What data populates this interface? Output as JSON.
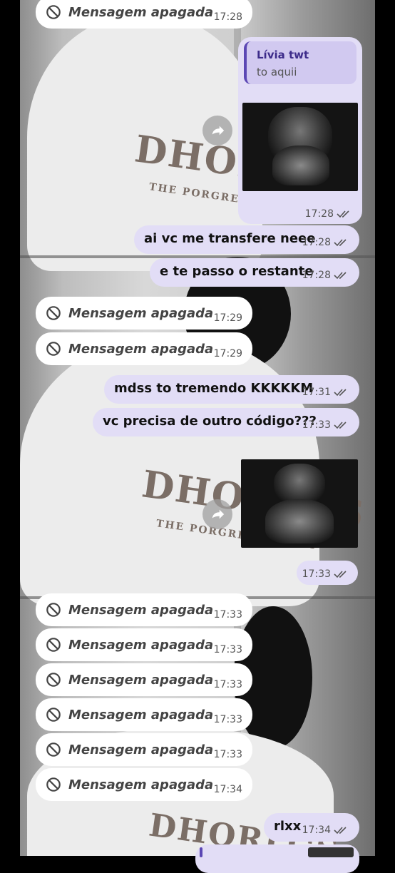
{
  "deleted_label": "Mensagem apagada",
  "quote": {
    "name": "Lívia twt",
    "text": "to aquii"
  },
  "messages": [
    {
      "time": "17:28"
    },
    {
      "time": "17:28"
    },
    {
      "text": "ai vc me transfere neee",
      "time": "17:28"
    },
    {
      "text": "e te passo o restante",
      "time": "17:28"
    },
    {
      "time": "17:29"
    },
    {
      "time": "17:29"
    },
    {
      "text": "mdss to tremendo KKKKKM",
      "time": "17:31"
    },
    {
      "text": "vc precisa de outro código???",
      "time": "17:33"
    },
    {
      "time": "17:33"
    },
    {
      "time": "17:33"
    },
    {
      "time": "17:33"
    },
    {
      "time": "17:33"
    },
    {
      "time": "17:33"
    },
    {
      "time": "17:33"
    },
    {
      "time": "17:34"
    },
    {
      "text": "rlxx",
      "time": "17:34"
    }
  ],
  "wallpaper_print": "DHORIT'S",
  "wallpaper_sub": "THE PORGREDOLLEHIT",
  "colors": {
    "incoming": "#ffffff",
    "outgoing": "#e2ddf6",
    "accent": "#5b47b4"
  },
  "icons": {
    "deleted": "ban-icon",
    "forward": "forward-icon",
    "read": "double-check-icon"
  }
}
